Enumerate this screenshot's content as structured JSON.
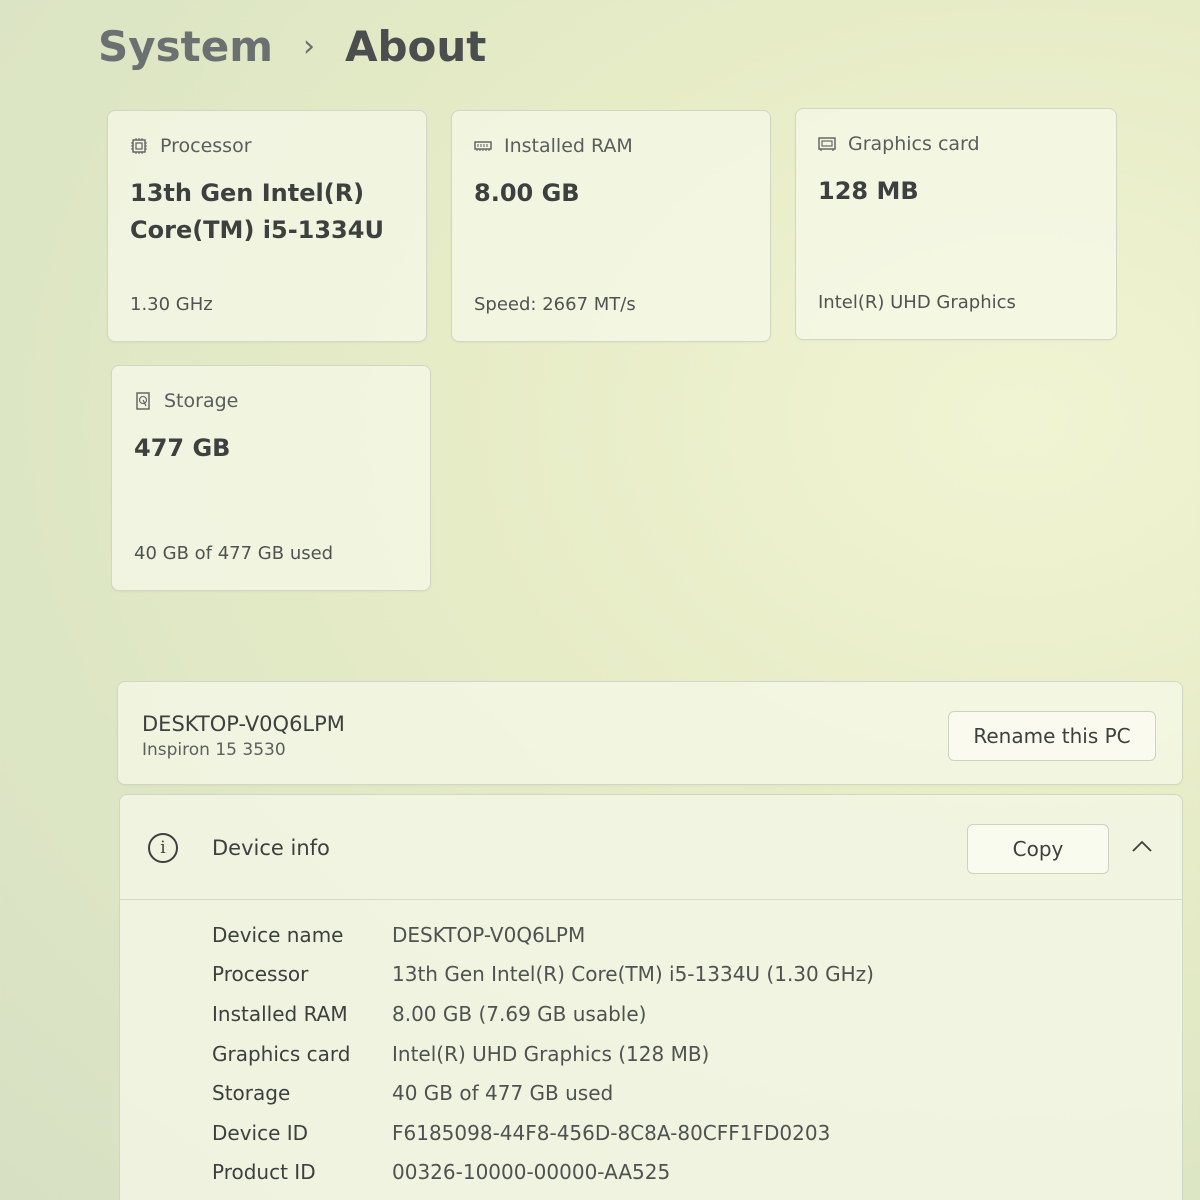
{
  "breadcrumb": {
    "parent": "System",
    "separator": "›",
    "current": "About"
  },
  "cards": {
    "processor": {
      "label": "Processor",
      "value": "13th Gen Intel(R) Core(TM) i5-1334U",
      "sub": "1.30 GHz",
      "icon": "processor-icon"
    },
    "ram": {
      "label": "Installed RAM",
      "value": "8.00 GB",
      "sub": "Speed: 2667 MT/s",
      "icon": "ram-icon"
    },
    "graphics": {
      "label": "Graphics card",
      "value": "128 MB",
      "sub": "Intel(R) UHD Graphics",
      "icon": "graphics-card-icon"
    },
    "storage": {
      "label": "Storage",
      "value": "477 GB",
      "sub": "40 GB of 477 GB used",
      "icon": "storage-icon"
    }
  },
  "pc": {
    "name": "DESKTOP-V0Q6LPM",
    "model": "Inspiron 15 3530",
    "rename_label": "Rename this PC"
  },
  "device_info": {
    "title": "Device info",
    "copy_label": "Copy",
    "rows": [
      {
        "label": "Device name",
        "value": "DESKTOP-V0Q6LPM"
      },
      {
        "label": "Processor",
        "value": "13th Gen Intel(R) Core(TM) i5-1334U (1.30 GHz)"
      },
      {
        "label": "Installed RAM",
        "value": "8.00 GB (7.69 GB usable)"
      },
      {
        "label": "Graphics card",
        "value": "Intel(R) UHD Graphics (128 MB)"
      },
      {
        "label": "Storage",
        "value": "40 GB of 477 GB used"
      },
      {
        "label": "Device ID",
        "value": "F6185098-44F8-456D-8C8A-80CFF1FD0203"
      },
      {
        "label": "Product ID",
        "value": "00326-10000-00000-AA525"
      }
    ]
  }
}
